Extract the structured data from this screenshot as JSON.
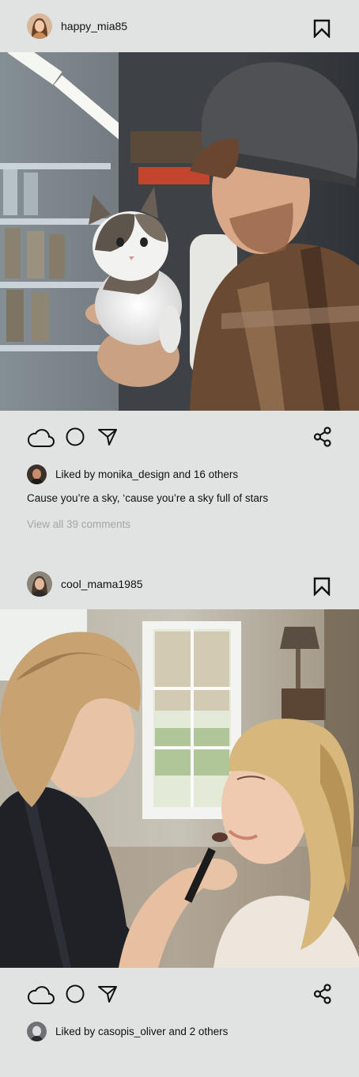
{
  "posts": [
    {
      "username": "happy_mia85",
      "image_description": "young man in beanie and plaid shirt holding a kitten in a pet store",
      "likes_text": "Liked by monika_design and 16 others",
      "caption": "Cause you’re a sky, ‘cause you’re a sky full of stars",
      "comments_link": "View all 39 comments"
    },
    {
      "username": "cool_mama1985",
      "image_description": "makeup artist applying makeup to a woman with curly blonde hair",
      "likes_text": "Liked by casopis_oliver and 2 others"
    }
  ],
  "icons": {
    "like": "cloud-icon",
    "comment": "circle-icon",
    "send": "paper-plane-icon",
    "share": "share-icon",
    "save": "bookmark-icon"
  },
  "colors": {
    "background": "#e1e3e3",
    "text": "#111111",
    "muted_text": "#a3a6a6"
  }
}
